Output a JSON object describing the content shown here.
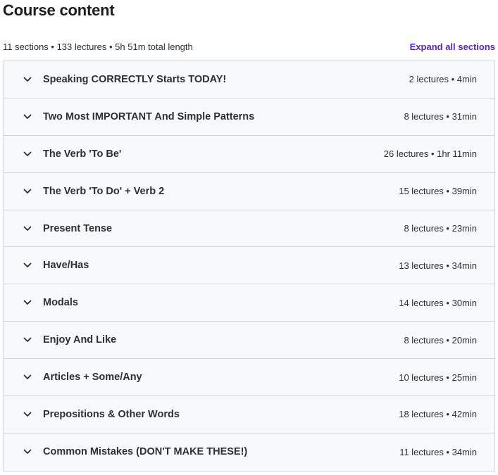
{
  "header": {
    "title": "Course content",
    "summary": "11 sections • 133 lectures • 5h 51m total length",
    "expand_all_label": "Expand all sections"
  },
  "sections": [
    {
      "title": "Speaking CORRECTLY Starts TODAY!",
      "meta": "2 lectures • 4min"
    },
    {
      "title": "Two Most IMPORTANT And Simple Patterns",
      "meta": "8 lectures • 31min"
    },
    {
      "title": "The Verb 'To Be'",
      "meta": "26 lectures • 1hr 11min"
    },
    {
      "title": "The Verb 'To Do' + Verb 2",
      "meta": "15 lectures • 39min"
    },
    {
      "title": "Present Tense",
      "meta": "8 lectures • 23min"
    },
    {
      "title": "Have/Has",
      "meta": "13 lectures • 34min"
    },
    {
      "title": "Modals",
      "meta": "14 lectures • 30min"
    },
    {
      "title": "Enjoy And Like",
      "meta": "8 lectures • 20min"
    },
    {
      "title": "Articles + Some/Any",
      "meta": "10 lectures • 25min"
    },
    {
      "title": "Prepositions & Other Words",
      "meta": "18 lectures • 42min"
    },
    {
      "title": "Common Mistakes (DON'T MAKE THESE!)",
      "meta": "11 lectures • 34min"
    }
  ],
  "icons": {
    "section_toggle": "chevron-down-icon"
  },
  "colors": {
    "accent": "#5624d0",
    "row_bg": "#f7f9fa",
    "border": "#d1d7dc",
    "text": "#2d2f31"
  }
}
